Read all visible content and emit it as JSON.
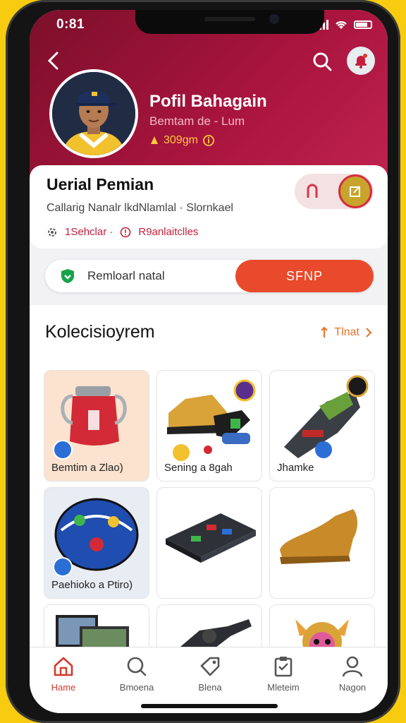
{
  "status": {
    "time": "0:81"
  },
  "profile": {
    "name": "Pofil Bahagain",
    "subtitle": "Bemtam de - Lum",
    "coins": "309gm"
  },
  "info": {
    "title": "Uerial Pemian",
    "description": "Callarig Nanalr lkdNlamlal · Slornkael",
    "meta_left": "1Sehclar ·",
    "meta_right": "R9anlaitclles"
  },
  "download": {
    "label": "Remloarl natal",
    "button": "SFNP"
  },
  "collection": {
    "title": "Kolecisioyrem",
    "link": "Tlnat",
    "items": [
      {
        "label": "Bemtim a Zlao)"
      },
      {
        "label": "Sening a 8gah"
      },
      {
        "label": "Jhamke"
      },
      {
        "label": "Paehioko a Ptiro)"
      },
      {
        "label": ""
      },
      {
        "label": ""
      },
      {
        "label": ""
      },
      {
        "label": ""
      },
      {
        "label": ""
      }
    ]
  },
  "nav": [
    {
      "label": "Hame",
      "icon": "home-icon"
    },
    {
      "label": "Bmoena",
      "icon": "search-icon"
    },
    {
      "label": "Blena",
      "icon": "tag-icon"
    },
    {
      "label": "Mleteim",
      "icon": "clipboard-icon"
    },
    {
      "label": "Nagon",
      "icon": "user-icon"
    }
  ],
  "colors": {
    "header": "#A8143E",
    "accent": "#E84A2B",
    "active_nav": "#D23A2E",
    "frame": "#F7CB10"
  }
}
